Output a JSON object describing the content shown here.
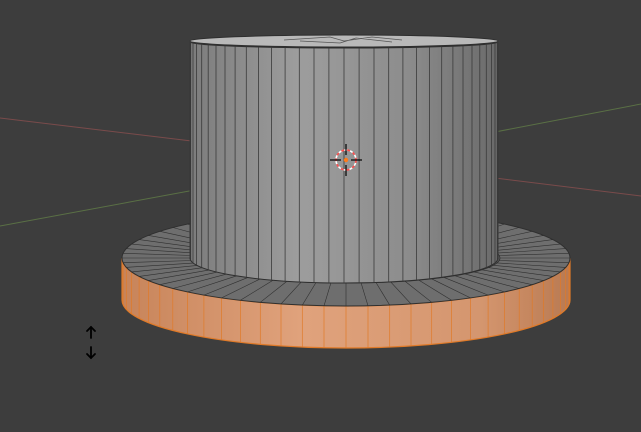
{
  "viewport": {
    "background_color": "#3d3d3d",
    "grid_axis_x_color": "#7a4b4b",
    "grid_axis_y_color": "#5a7045",
    "cylinder_face_color": "#8f8f8f",
    "cylinder_wire_color": "#3a3a3a",
    "cylinder_top_color": "#bdbdbd",
    "base_selected_color": "#d98f5c",
    "base_selected_wire_color": "#e07a28",
    "base_top_color": "#6e6e6e",
    "cursor_ring_colors": [
      "#ff4d4d",
      "#ffffff"
    ]
  },
  "cylinder_segments": 64,
  "base_segments": 64,
  "icons": {
    "cursor": "3d-cursor-icon",
    "scale_arrows": "vertical-arrows-icon"
  }
}
